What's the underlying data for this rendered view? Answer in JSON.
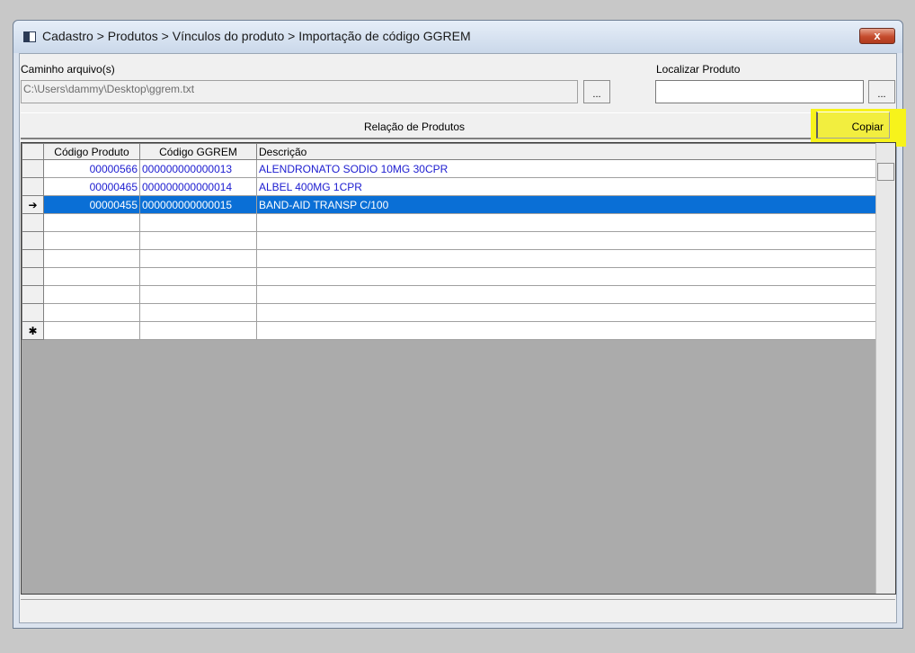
{
  "window": {
    "title": "Cadastro > Produtos > Vínculos do produto > Importação de código GGREM",
    "close_label": "x"
  },
  "file_path": {
    "label": "Caminho arquivo(s)",
    "value": "C:\\Users\\dammy\\Desktop\\ggrem.txt",
    "browse_label": "..."
  },
  "find_product": {
    "label": "Localizar Produto",
    "value": "",
    "browse_label": "..."
  },
  "section": {
    "title": "Relação de Produtos",
    "copy_label": "Copiar"
  },
  "grid": {
    "columns": [
      "Código Produto",
      "Código GGREM",
      "Descrição"
    ],
    "rows": [
      {
        "codigo_produto": "00000566",
        "codigo_ggrem": "000000000000013",
        "descricao": "ALENDRONATO SODIO 10MG 30CPR"
      },
      {
        "codigo_produto": "00000465",
        "codigo_ggrem": "000000000000014",
        "descricao": "ALBEL 400MG 1CPR"
      },
      {
        "codigo_produto": "00000455",
        "codigo_ggrem": "000000000000015",
        "descricao": "BAND-AID TRANSP C/100"
      }
    ],
    "selected_row_marker": "➔",
    "new_row_marker": "✱"
  },
  "colors": {
    "highlight": "#f7f31b",
    "selection": "#0a6fd6",
    "row_text": "#1c1cd0"
  }
}
